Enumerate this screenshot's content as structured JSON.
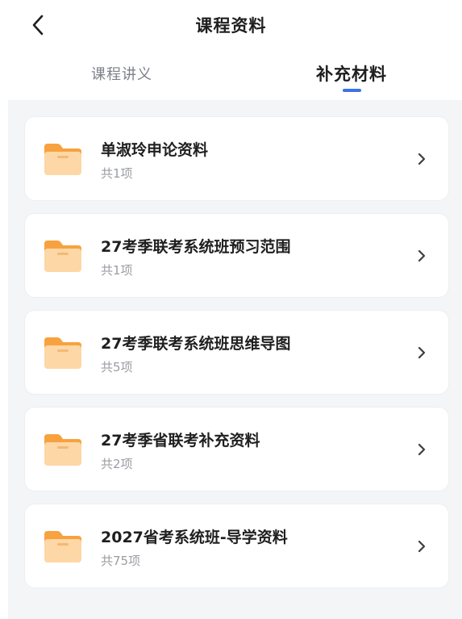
{
  "header": {
    "title": "课程资料",
    "back_icon": "chevron-left-icon"
  },
  "tabs": [
    {
      "label": "课程讲义",
      "active": false
    },
    {
      "label": "补充材料",
      "active": true
    }
  ],
  "colors": {
    "accent": "#3b73e8",
    "folder": "#f7a23f",
    "folder_light": "#fdd7a6",
    "background": "#f4f5f7"
  },
  "folders": [
    {
      "name": "单淑玲申论资料",
      "count": "共1项",
      "icon": "folder-icon"
    },
    {
      "name": "27考季联考系统班预习范围",
      "count": "共1项",
      "icon": "folder-icon"
    },
    {
      "name": "27考季联考系统班思维导图",
      "count": "共5项",
      "icon": "folder-icon"
    },
    {
      "name": "27考季省联考补充资料",
      "count": "共2项",
      "icon": "folder-icon"
    },
    {
      "name": "2027省考系统班-导学资料",
      "count": "共75项",
      "icon": "folder-icon"
    }
  ]
}
